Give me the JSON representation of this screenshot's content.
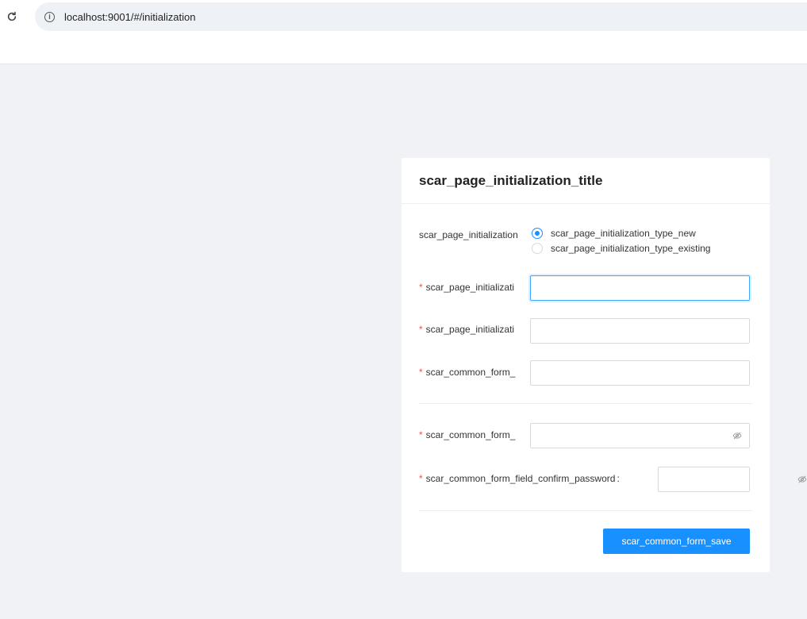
{
  "browser": {
    "url": "localhost:9001/#/initialization",
    "reload_icon": "reload-icon",
    "info_icon": "info-icon"
  },
  "form": {
    "title": "scar_page_initialization_title",
    "type_label": "scar_page_initialization",
    "type_options": [
      {
        "label": "scar_page_initialization_type_new",
        "selected": true
      },
      {
        "label": "scar_page_initialization_type_existing",
        "selected": false
      }
    ],
    "fields": [
      {
        "label": "scar_page_initializati",
        "required": true,
        "value": ""
      },
      {
        "label": "scar_page_initializati",
        "required": true,
        "value": ""
      },
      {
        "label": "scar_common_form_",
        "required": true,
        "value": ""
      }
    ],
    "password_fields": [
      {
        "label": "scar_common_form_",
        "required": true,
        "value": "",
        "icon": "eye-invisible-icon"
      },
      {
        "label": "scar_common_form_field_confirm_password",
        "suffix": ":",
        "required": true,
        "value": "",
        "icon": "eye-invisible-icon"
      }
    ],
    "save_label": "scar_common_form_save"
  },
  "colors": {
    "primary": "#1890ff",
    "required": "#ff4d4f",
    "background": "#f0f2f5"
  }
}
